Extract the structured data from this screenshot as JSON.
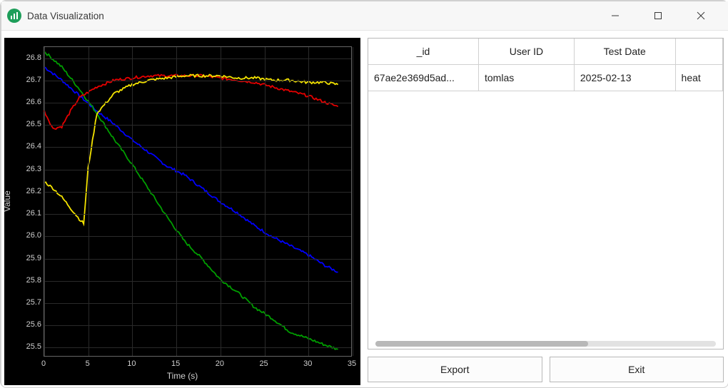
{
  "window": {
    "title": "Data Visualization"
  },
  "buttons": {
    "export": "Export",
    "exit": "Exit"
  },
  "table": {
    "headers": [
      "_id",
      "User ID",
      "Test Date",
      ""
    ],
    "rows": [
      {
        "id": "67ae2e369d5ad...",
        "user": "tomlas",
        "date": "2025-02-13",
        "extra": "heat"
      }
    ]
  },
  "chart": {
    "xlabel": "Time (s)",
    "ylabel": "Value",
    "x_ticks": [
      0,
      5,
      10,
      15,
      20,
      25,
      30,
      35
    ],
    "y_ticks": [
      25.5,
      25.6,
      25.7,
      25.8,
      25.9,
      26.0,
      26.1,
      26.2,
      26.3,
      26.4,
      26.5,
      26.6,
      26.7,
      26.8
    ]
  },
  "chart_data": {
    "type": "line",
    "title": "",
    "xlabel": "Time (s)",
    "ylabel": "Value",
    "xlim": [
      0,
      35
    ],
    "ylim": [
      25.45,
      26.85
    ],
    "series": [
      {
        "name": "blue",
        "color": "#0000ff",
        "x": [
          0,
          2,
          4,
          6,
          8,
          10,
          12,
          14,
          16,
          18,
          20,
          22,
          24,
          26,
          28,
          30,
          32,
          33.5
        ],
        "values": [
          26.76,
          26.7,
          26.63,
          26.56,
          26.5,
          26.43,
          26.37,
          26.31,
          26.27,
          26.21,
          26.15,
          26.1,
          26.04,
          25.99,
          25.95,
          25.91,
          25.86,
          25.83
        ]
      },
      {
        "name": "green",
        "color": "#009e00",
        "x": [
          0,
          2,
          4,
          6,
          8,
          10,
          12,
          14,
          16,
          18,
          20,
          22,
          24,
          26,
          28,
          30,
          32,
          33.5
        ],
        "values": [
          26.83,
          26.76,
          26.66,
          26.55,
          26.43,
          26.32,
          26.2,
          26.08,
          25.97,
          25.89,
          25.8,
          25.74,
          25.67,
          25.62,
          25.56,
          25.53,
          25.5,
          25.48
        ]
      },
      {
        "name": "red",
        "color": "#e60000",
        "x": [
          0,
          1,
          2,
          3,
          4,
          6,
          8,
          10,
          12,
          14,
          16,
          18,
          20,
          22,
          24,
          26,
          28,
          30,
          32,
          33.5
        ],
        "values": [
          26.56,
          26.48,
          26.49,
          26.56,
          26.62,
          26.67,
          26.7,
          26.71,
          26.72,
          26.72,
          26.72,
          26.72,
          26.71,
          26.7,
          26.69,
          26.67,
          26.65,
          26.63,
          26.6,
          26.58
        ]
      },
      {
        "name": "yellow",
        "color": "#f5e400",
        "x": [
          0,
          1,
          2,
          3,
          4,
          4.5,
          5,
          6,
          8,
          10,
          12,
          14,
          16,
          18,
          20,
          22,
          24,
          26,
          28,
          30,
          32,
          33.5
        ],
        "values": [
          26.24,
          26.21,
          26.17,
          26.12,
          26.07,
          26.05,
          26.3,
          26.55,
          26.64,
          26.68,
          26.7,
          26.71,
          26.72,
          26.72,
          26.72,
          26.71,
          26.71,
          26.7,
          26.7,
          26.69,
          26.69,
          26.68
        ]
      }
    ]
  }
}
